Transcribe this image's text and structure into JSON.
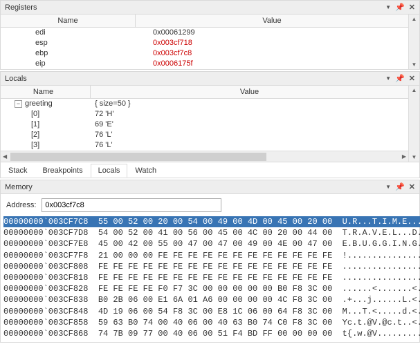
{
  "panels": {
    "registers": "Registers",
    "locals": "Locals",
    "memory": "Memory"
  },
  "columns": {
    "name": "Name",
    "value": "Value"
  },
  "registers": [
    {
      "name": "edi",
      "value": "0x00061299",
      "changed": false
    },
    {
      "name": "esp",
      "value": "0x003cf718",
      "changed": true
    },
    {
      "name": "ebp",
      "value": "0x003cf7c8",
      "changed": true
    },
    {
      "name": "eip",
      "value": "0x0006175f",
      "changed": true
    }
  ],
  "locals": {
    "root": {
      "name": "greeting",
      "value": "{ size=50 }"
    },
    "children": [
      {
        "name": "[0]",
        "value": "72 'H'"
      },
      {
        "name": "[1]",
        "value": "69 'E'"
      },
      {
        "name": "[2]",
        "value": "76 'L'"
      },
      {
        "name": "[3]",
        "value": "76 'L'"
      }
    ]
  },
  "tabs": [
    {
      "label": "Stack",
      "active": false
    },
    {
      "label": "Breakpoints",
      "active": false
    },
    {
      "label": "Locals",
      "active": true
    },
    {
      "label": "Watch",
      "active": false
    }
  ],
  "memory": {
    "address_label": "Address:",
    "address_value": "0x003cf7c8",
    "rows": [
      {
        "addr": "00000000`003CF7C8",
        "hex": "55 00 52 00 20 00 54 00 49 00 4D 00 45 00 20 00",
        "ascii": "U.R...T.I.M.E...",
        "selected": true
      },
      {
        "addr": "00000000`003CF7D8",
        "hex": "54 00 52 00 41 00 56 00 45 00 4C 00 20 00 44 00",
        "ascii": "T.R.A.V.E.L...D."
      },
      {
        "addr": "00000000`003CF7E8",
        "hex": "45 00 42 00 55 00 47 00 47 00 49 00 4E 00 47 00",
        "ascii": "E.B.U.G.G.I.N.G."
      },
      {
        "addr": "00000000`003CF7F8",
        "hex": "21 00 00 00 FE FE FE FE FE FE FE FE FE FE FE FE",
        "ascii": "!..............."
      },
      {
        "addr": "00000000`003CF808",
        "hex": "FE FE FE FE FE FE FE FE FE FE FE FE FE FE FE FE",
        "ascii": "................"
      },
      {
        "addr": "00000000`003CF818",
        "hex": "FE FE FE FE FE FE FE FE FE FE FE FE FE FE FE FE",
        "ascii": "................"
      },
      {
        "addr": "00000000`003CF828",
        "hex": "FE FE FE FE F0 F7 3C 00 00 00 00 00 B0 F8 3C 00",
        "ascii": "......<.......<."
      },
      {
        "addr": "00000000`003CF838",
        "hex": "B0 2B 06 00 E1 6A 01 A6 00 00 00 00 4C F8 3C 00",
        "ascii": ".+...j......L.<."
      },
      {
        "addr": "00000000`003CF848",
        "hex": "4D 19 06 00 54 F8 3C 00 E8 1C 06 00 64 F8 3C 00",
        "ascii": "M...T.<.....d.<."
      },
      {
        "addr": "00000000`003CF858",
        "hex": "59 63 B0 74 00 40 06 00 40 63 B0 74 C0 F8 3C 00",
        "ascii": "Yc.t.@V.@c.t..<."
      },
      {
        "addr": "00000000`003CF868",
        "hex": "74 7B 09 77 00 40 06 00 51 F4 BD FF 00 00 00 00",
        "ascii": "t{.w.@V........."
      }
    ]
  }
}
